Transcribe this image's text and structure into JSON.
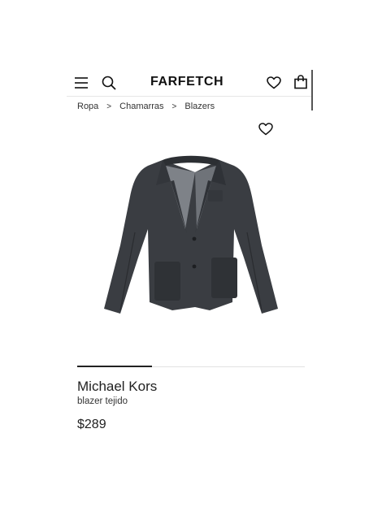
{
  "header": {
    "logo": "FARFETCH",
    "menu_icon": "hamburger-menu-icon",
    "search_icon": "search-icon",
    "wishlist_icon": "heart-icon",
    "bag_icon": "shopping-bag-icon"
  },
  "breadcrumb": {
    "items": [
      "Ropa",
      "Chamarras",
      "Blazers"
    ],
    "separator": ">"
  },
  "product": {
    "brand": "Michael Kors",
    "description": "blazer tejido",
    "price": "$289",
    "wishlist_icon": "heart-icon",
    "color": "#3a3d42"
  },
  "gallery": {
    "progress": 0.33
  }
}
